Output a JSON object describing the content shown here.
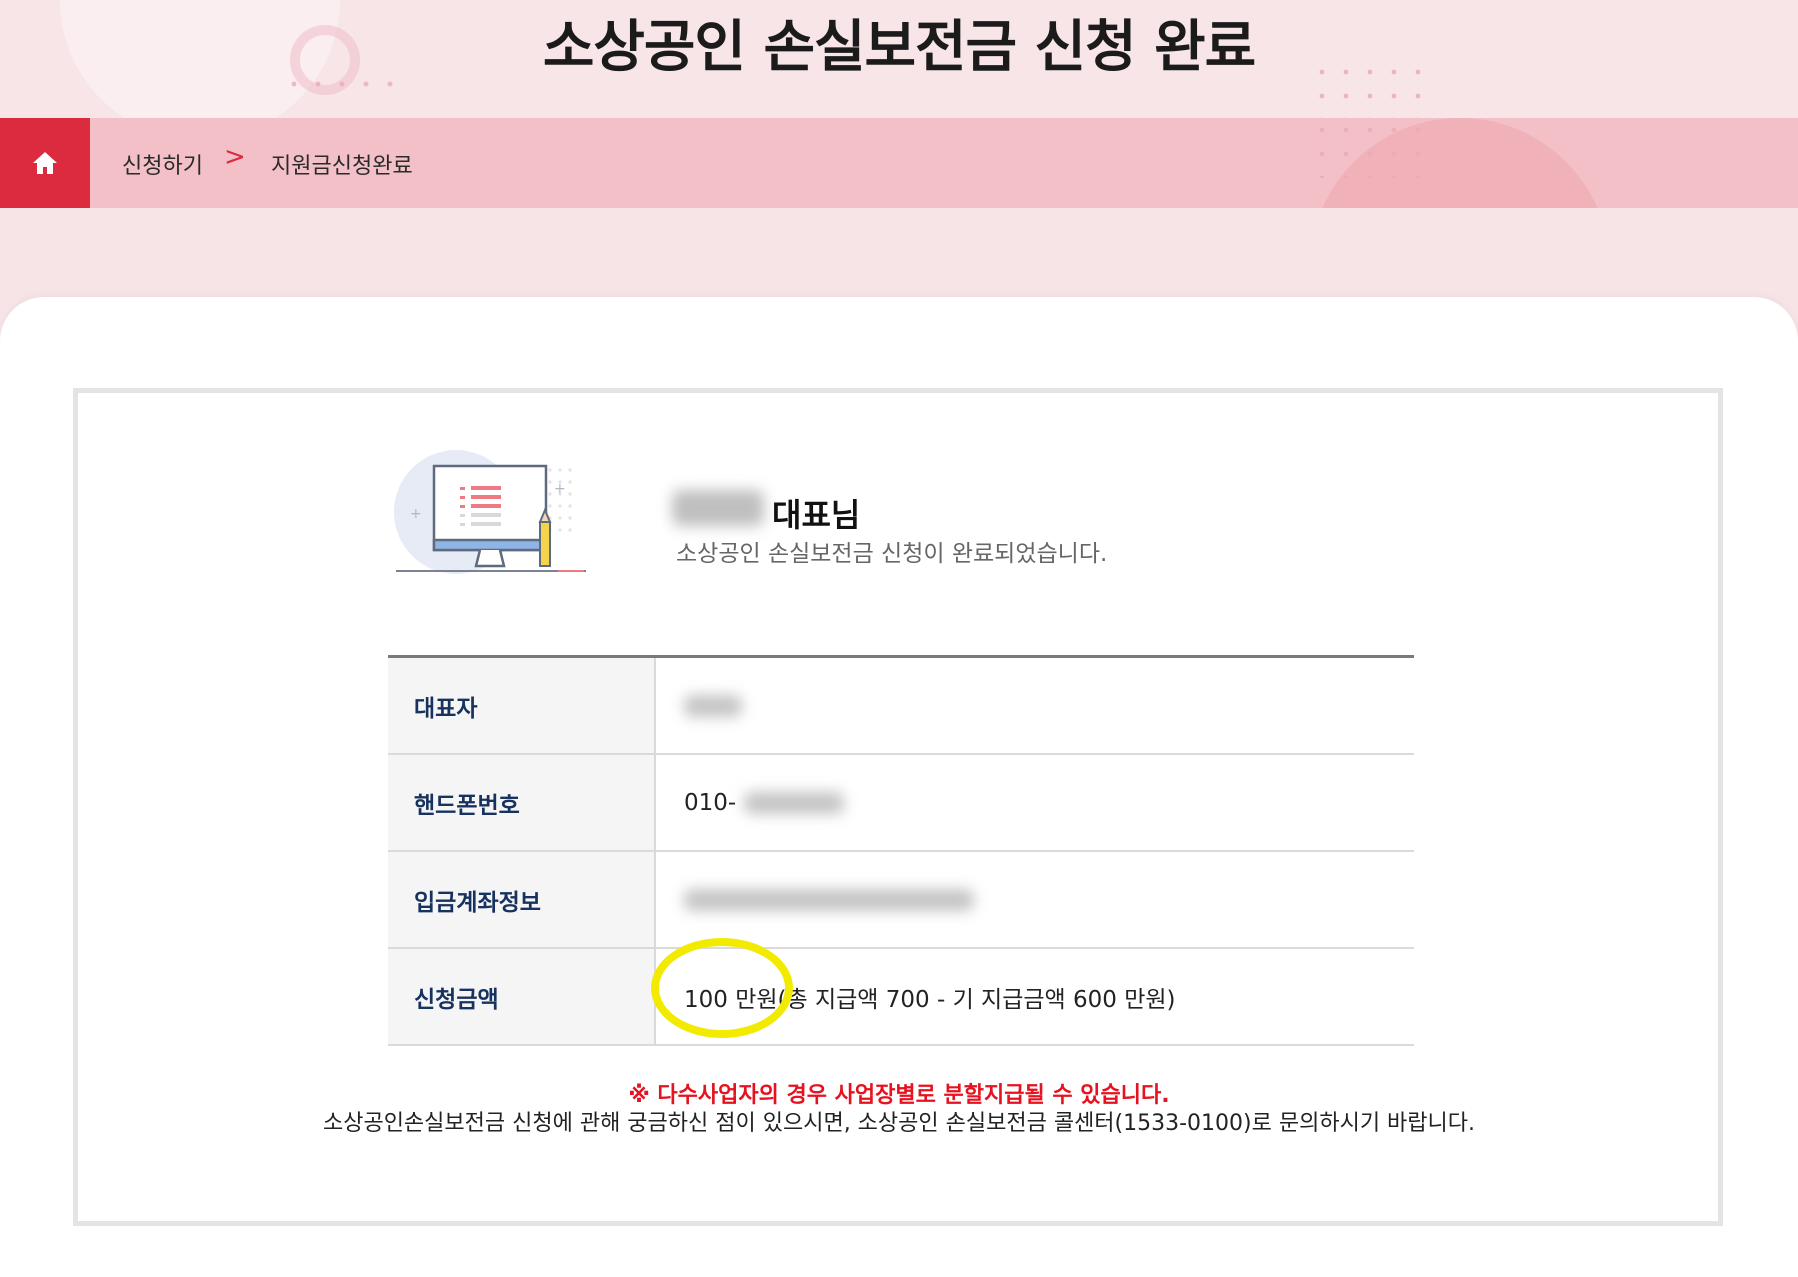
{
  "page": {
    "title": "소상공인 손실보전금 신청 완료"
  },
  "breadcrumb": {
    "items": [
      "신청하기",
      "지원금신청완료"
    ],
    "separator": ">"
  },
  "greeting": {
    "title": "대표님",
    "message": "소상공인 손실보전금 신청이 완료되었습니다."
  },
  "info_table": {
    "rows": [
      {
        "label": "대표자",
        "value": ""
      },
      {
        "label": "핸드폰번호",
        "value": "010-"
      },
      {
        "label": "입금계좌정보",
        "value": ""
      },
      {
        "label": "신청금액",
        "value": "100 만원(총 지급액 700 - 기 지급금액 600 만원)"
      }
    ]
  },
  "notices": {
    "warning": "※ 다수사업자의 경우 사업장별로 분할지급될 수 있습니다.",
    "contact": "소상공인손실보전금 신청에 관해 궁금하신 점이 있으시면, 소상공인 손실보전금 콜센터(1533-0100)로 문의하시기 바랍니다."
  },
  "colors": {
    "accent": "#dc2b3f",
    "hero_bg": "#f7e5e8",
    "breadcrumb_bg": "#f2c0c6",
    "label_text": "#17325e",
    "warning_text": "#e6121f",
    "highlight": "#f2eb00"
  },
  "icons": {
    "home": "home-icon",
    "breadcrumb_separator": "chevron-right-icon"
  }
}
